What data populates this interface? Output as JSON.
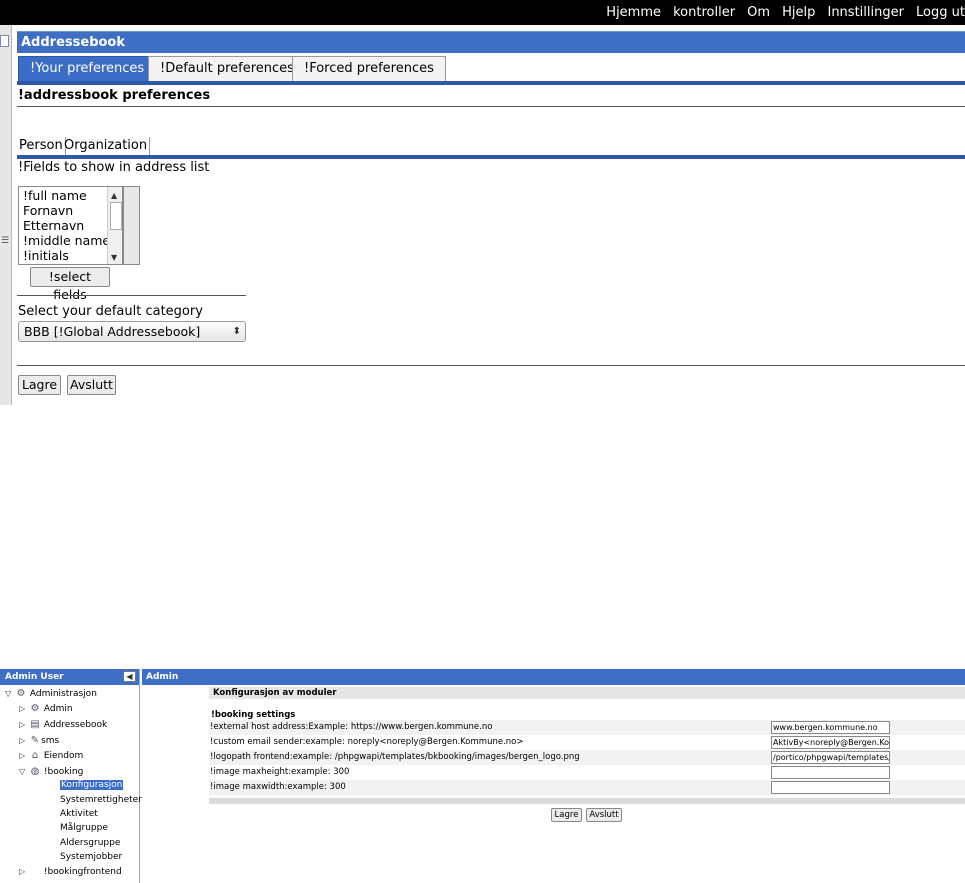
{
  "top_nav": {
    "items": [
      "Hjemme",
      "kontroller",
      "Om",
      "Hjelp",
      "Innstillinger",
      "Logg ut"
    ]
  },
  "addressbook": {
    "title": "Addressebook",
    "tabs": [
      "!Your preferences",
      "!Default preferences",
      "!Forced preferences"
    ],
    "active_tab": 0,
    "pref_title": "!addressbook preferences",
    "subtabs": [
      "Person",
      "Organization"
    ],
    "fields_label": "!Fields to show in address list",
    "fields": [
      "!full name",
      "Fornavn",
      "Etternavn",
      "!middle name",
      "!initials"
    ],
    "select_fields_button": "!select fields",
    "category_label": "Select your default category",
    "category_value": "BBB [!Global Addressebook]",
    "save_button": "Lagre",
    "cancel_button": "Avslutt"
  },
  "admin": {
    "sidebar_title": "Admin User",
    "main_title": "Admin",
    "tree": [
      {
        "label": "Administrasjon",
        "icon": "gear-icon",
        "level": 0,
        "expanded": true
      },
      {
        "label": "Admin",
        "icon": "gear-icon",
        "level": 1,
        "expanded": false
      },
      {
        "label": "Addressebook",
        "icon": "addressbook-icon",
        "level": 1,
        "expanded": false
      },
      {
        "label": "sms",
        "icon": "phone-icon",
        "level": 1,
        "expanded": false
      },
      {
        "label": "Eiendom",
        "icon": "building-icon",
        "level": 1,
        "expanded": false
      },
      {
        "label": "!booking",
        "icon": "globe-icon",
        "level": 1,
        "expanded": true
      },
      {
        "label": "Konfigurasjon",
        "level": 2,
        "selected": true
      },
      {
        "label": "Systemrettigheter",
        "level": 2
      },
      {
        "label": "Aktivitet",
        "level": 2
      },
      {
        "label": "Målgruppe",
        "level": 2
      },
      {
        "label": "Aldersgruppe",
        "level": 2
      },
      {
        "label": "Systemjobber",
        "level": 2
      },
      {
        "label": "!bookingfrontend",
        "level": 1,
        "expanded": false
      }
    ],
    "config_title": "Konfigurasjon av moduler",
    "booking_title": "!booking settings",
    "settings": [
      {
        "label": "!external host address:Example: https://www.bergen.kommune.no",
        "value": "www.bergen.kommune.no"
      },
      {
        "label": "!custom email sender:example: noreply<noreply@Bergen.Kommune.no>",
        "value": "AktivBy<noreply@Bergen.Ko"
      },
      {
        "label": "!logopath frontend:example: /phpgwapi/templates/bkbooking/images/bergen_logo.png",
        "value": "/portico/phpgwapi/templates/"
      },
      {
        "label": "!image maxheight:example: 300",
        "value": ""
      },
      {
        "label": "!image maxwidth:example: 300",
        "value": ""
      }
    ],
    "save_button": "Lagre",
    "cancel_button": "Avslutt"
  }
}
